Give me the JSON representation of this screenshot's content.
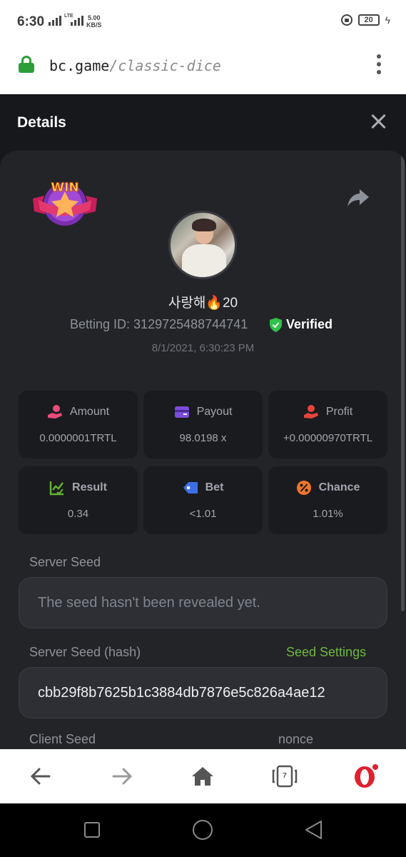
{
  "status_bar": {
    "time": "6:30",
    "lte": "LTE",
    "speed_value": "5.00",
    "speed_unit": "KB/S",
    "battery": "20"
  },
  "browser": {
    "url_domain": "bc.game",
    "url_path": "/classic-dice",
    "tabs_count": "7"
  },
  "details": {
    "title": "Details",
    "badge_text": "WIN",
    "username": "사랑해🔥20",
    "betting_id": "Betting ID: 3129725488744741",
    "verified": "Verified",
    "datetime": "8/1/2021, 6:30:23 PM",
    "stats": [
      {
        "label": "Amount",
        "value": "0.0000001TRTL",
        "icon": "coins-hand-icon",
        "color": "#ea4c7b"
      },
      {
        "label": "Payout",
        "value": "98.0198 x",
        "icon": "wallet-card-icon",
        "color": "#7b4ddb"
      },
      {
        "label": "Profit",
        "value": "+0.00000970TRTL",
        "icon": "profit-hand-icon",
        "color": "#e4453b"
      },
      {
        "label": "Result",
        "value": "0.34",
        "icon": "chart-check-icon",
        "color": "#62b233"
      },
      {
        "label": "Bet",
        "value": "<1.01",
        "icon": "tag-icon",
        "color": "#3b6fe8"
      },
      {
        "label": "Chance",
        "value": "1.01%",
        "icon": "percent-icon",
        "color": "#f0752c"
      }
    ],
    "server_seed_label": "Server Seed",
    "server_seed_value": "The seed hasn't been revealed yet.",
    "server_seed_hash_label": "Server Seed (hash)",
    "seed_settings": "Seed Settings",
    "server_seed_hash_value": "cbb29f8b7625b1c3884db7876e5c826a4ae12",
    "client_seed_label": "Client Seed",
    "nonce_label": "nonce"
  }
}
